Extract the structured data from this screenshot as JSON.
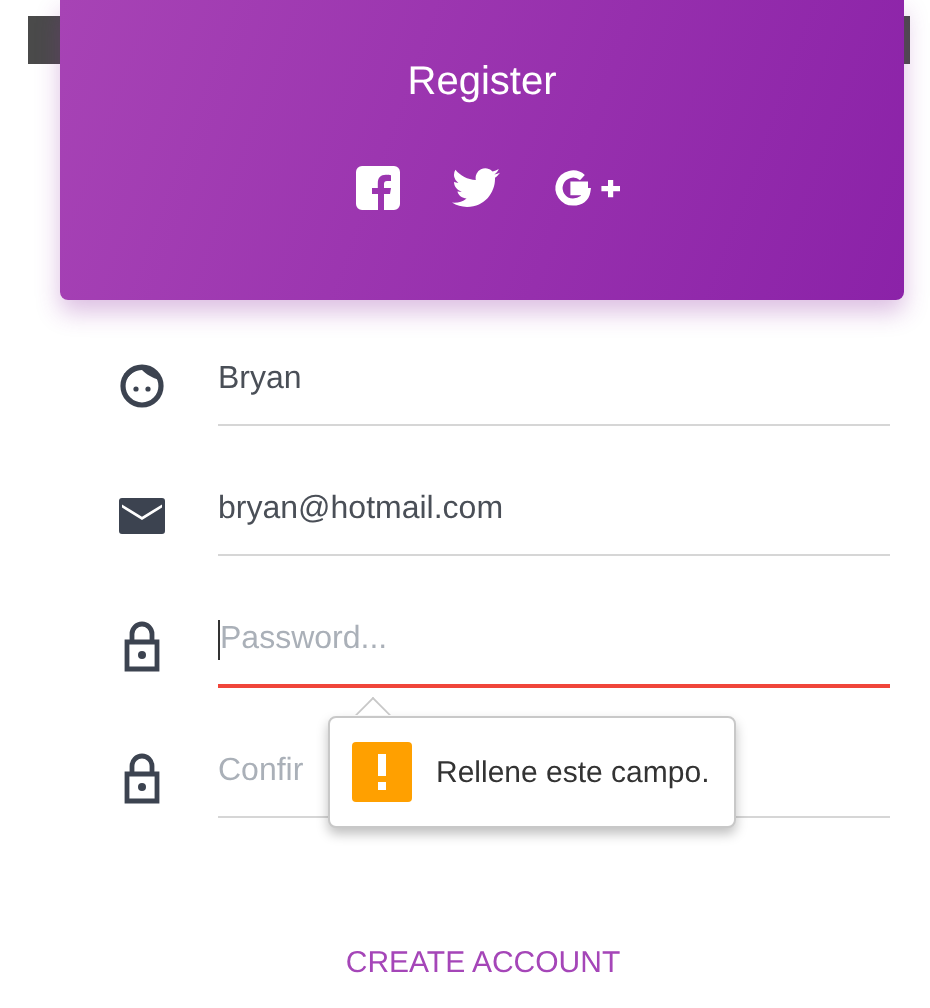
{
  "header": {
    "title": "Register",
    "social": [
      {
        "kind": "facebook"
      },
      {
        "kind": "twitter"
      },
      {
        "kind": "google-plus"
      }
    ]
  },
  "fields": [
    {
      "kind": "name",
      "value": "Bryan",
      "error": false,
      "focused": false
    },
    {
      "kind": "email",
      "value": "bryan@hotmail.com",
      "error": false,
      "focused": false
    },
    {
      "kind": "password",
      "placeholder": "Password...",
      "error": true,
      "focused": true,
      "tooltip": "Rellene este campo."
    },
    {
      "kind": "password",
      "placeholder": "Confir",
      "error": false,
      "focused": false
    }
  ],
  "button": "CREATE ACCOUNT"
}
